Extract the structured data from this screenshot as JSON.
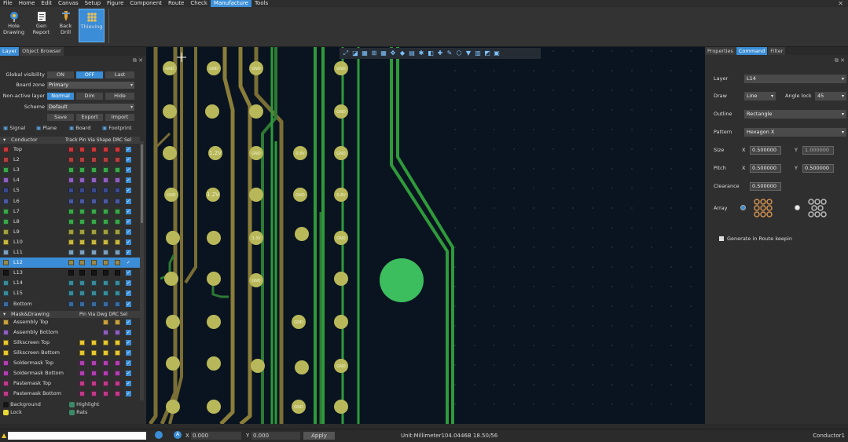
{
  "menu": [
    "File",
    "Home",
    "Edit",
    "Canvas",
    "Setup",
    "Figure",
    "Component",
    "Route",
    "Check",
    "Manufacture",
    "Tools"
  ],
  "menu_active": "Manufacture",
  "ribbon": {
    "buttons": [
      {
        "label1": "Hole",
        "label2": "Drawing",
        "icon": "hole-drawing-icon"
      },
      {
        "label1": "Gen",
        "label2": "Report",
        "icon": "report-icon"
      },
      {
        "label1": "Back",
        "label2": "Drill",
        "icon": "back-drill-icon"
      },
      {
        "label1": "Thieving",
        "label2": "",
        "icon": "thieving-icon"
      }
    ]
  },
  "left": {
    "tabs": [
      "Layer",
      "Object Browser"
    ],
    "global_visibility": {
      "label": "Global visibility",
      "on": "ON",
      "off": "OFF",
      "last": "Last"
    },
    "board_zone": {
      "label": "Board zone",
      "value": "Primary"
    },
    "non_active_layer": {
      "label": "Non-active layer",
      "normal": "Normal",
      "dim": "Dim",
      "hide": "Hide"
    },
    "scheme": {
      "label": "Scheme",
      "value": "Default",
      "save": "Save",
      "export": "Export",
      "import": "Import"
    },
    "filter_tabs": [
      "Signal",
      "Plane",
      "Board",
      "Footprint"
    ],
    "conductor_header": "Conductor",
    "conductor_cols": "Track Pin Via Shape DRC Sel",
    "layers": [
      {
        "name": "Top",
        "color": "#c8393c"
      },
      {
        "name": "L2",
        "color": "#b04040"
      },
      {
        "name": "L3",
        "color": "#3aa84a"
      },
      {
        "name": "L4",
        "color": "#8e5fbf"
      },
      {
        "name": "L5",
        "color": "#3a4a8c"
      },
      {
        "name": "L6",
        "color": "#4a5aa0"
      },
      {
        "name": "L7",
        "color": "#3aa84a"
      },
      {
        "name": "L8",
        "color": "#3aa84a"
      },
      {
        "name": "L9",
        "color": "#a0a040"
      },
      {
        "name": "L10",
        "color": "#c8b840"
      },
      {
        "name": "L11",
        "color": "#7aa0c0"
      },
      {
        "name": "L12",
        "color": "#9c8a4a"
      },
      {
        "name": "L13",
        "color": "#151515"
      },
      {
        "name": "L14",
        "color": "#3a8a9a"
      },
      {
        "name": "L15",
        "color": "#3a8a9a"
      },
      {
        "name": "Bottom",
        "color": "#3a6aa0"
      }
    ],
    "mask_header": "Mask&Drawing",
    "mask_cols": "Pin Via Dwg DRC Sel",
    "masks": [
      {
        "name": "Assembly Top",
        "color": "#c8a040"
      },
      {
        "name": "Assembly Bottom",
        "color": "#8e5fbf"
      },
      {
        "name": "Silkscreen Top",
        "color": "#e8c830"
      },
      {
        "name": "Silkscreen Bottom",
        "color": "#e8c830"
      },
      {
        "name": "Soldermask Top",
        "color": "#b040b0"
      },
      {
        "name": "Soldermask Bottom",
        "color": "#b040b0"
      },
      {
        "name": "Pastemask Top",
        "color": "#c03a8a"
      },
      {
        "name": "Pastemask Bottom",
        "color": "#c03a8a"
      }
    ],
    "legend": [
      {
        "name": "Background",
        "color": "#151515"
      },
      {
        "name": "Highlight",
        "color": "#3a8a6a"
      },
      {
        "name": "Lock",
        "color": "#e8d830"
      },
      {
        "name": "Rats",
        "color": "#3a8a6a"
      }
    ]
  },
  "canvas": {
    "pad_labels": {
      "gnd": "GND",
      "v12": "1.2V",
      "v08": "0.8V",
      "v33": "3.3V"
    }
  },
  "right": {
    "tabs": [
      "Properties",
      "Command",
      "Filter"
    ],
    "layer": {
      "label": "Layer",
      "value": "L14"
    },
    "draw": {
      "label": "Draw",
      "value": "Line"
    },
    "angle_lock": {
      "label": "Angle lock",
      "value": "45"
    },
    "outline": {
      "label": "Outline",
      "value": "Rectangle"
    },
    "pattern": {
      "label": "Pattern",
      "value": "Hexagon X"
    },
    "size": {
      "label": "Size",
      "x": "0.500000",
      "y": "1.000000"
    },
    "pitch": {
      "label": "Pitch",
      "x": "0.500000",
      "y": "0.500000"
    },
    "clearance": {
      "label": "Clearance",
      "value": "0.500000"
    },
    "array_label": "Array",
    "generate": "Generate in Route keepin"
  },
  "status": {
    "x_label": "X",
    "x": "0.000",
    "y_label": "Y",
    "y": "0.000",
    "apply": "Apply",
    "unit": "Unit:Millimeter104.0446B 18.50/56",
    "right": "Conductor1"
  }
}
